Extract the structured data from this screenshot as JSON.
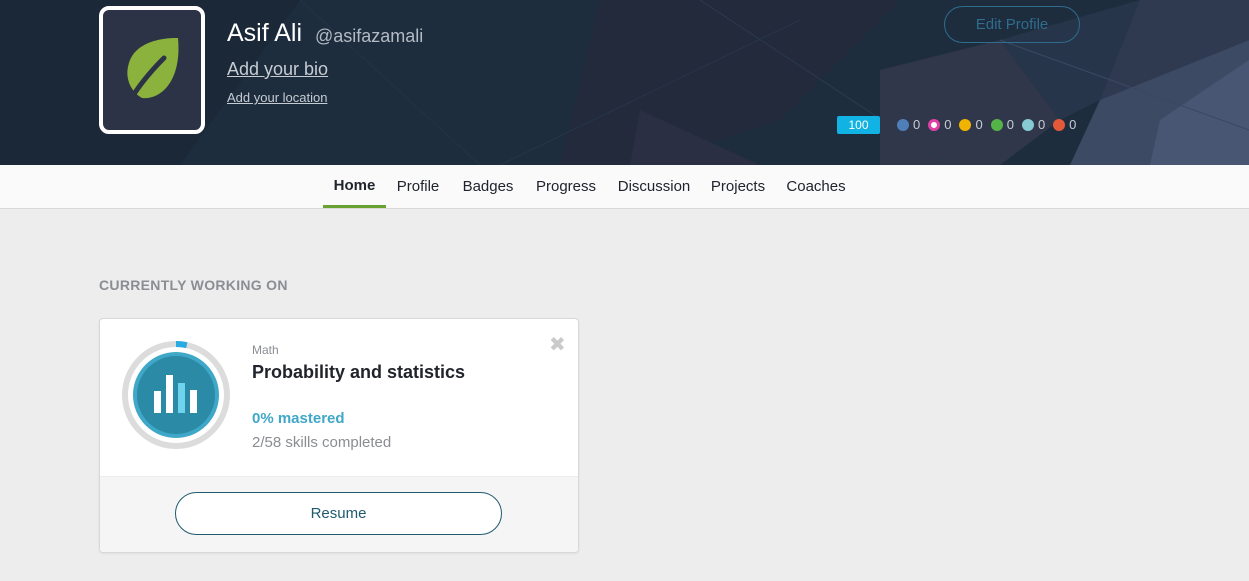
{
  "header": {
    "name": "Asif Ali",
    "username": "@asifazamali",
    "add_bio": "Add your bio",
    "add_location": "Add your location",
    "edit_profile": "Edit Profile",
    "points": "100",
    "badges": [
      {
        "icon": "blue-shield-badge-icon",
        "color": "#4f7fb8",
        "count": "0"
      },
      {
        "icon": "pink-ring-badge-icon",
        "color": "#e040a5",
        "count": "0"
      },
      {
        "icon": "gold-badge-icon",
        "color": "#f0b400",
        "count": "0"
      },
      {
        "icon": "green-badge-icon",
        "color": "#55b448",
        "count": "0"
      },
      {
        "icon": "teal-badge-icon",
        "color": "#86cbd3",
        "count": "0"
      },
      {
        "icon": "orange-badge-icon",
        "color": "#e5593a",
        "count": "0"
      }
    ]
  },
  "nav": {
    "tabs": [
      {
        "label": "Home",
        "active": true
      },
      {
        "label": "Profile",
        "active": false
      },
      {
        "label": "Badges",
        "active": false
      },
      {
        "label": "Progress",
        "active": false
      },
      {
        "label": "Discussion",
        "active": false
      },
      {
        "label": "Projects",
        "active": false
      },
      {
        "label": "Coaches",
        "active": false
      }
    ]
  },
  "main": {
    "section_title": "CURRENTLY WORKING ON",
    "card": {
      "subject": "Math",
      "title": "Probability and statistics",
      "mastered": "0% mastered",
      "skills": "2/58 skills completed",
      "skill_progress": 0.034,
      "resume": "Resume",
      "close_icon": "close-icon"
    }
  },
  "colors": {
    "accent_green": "#69a232",
    "accent_blue": "#10b3e3",
    "course_teal": "#3fa7c8"
  }
}
